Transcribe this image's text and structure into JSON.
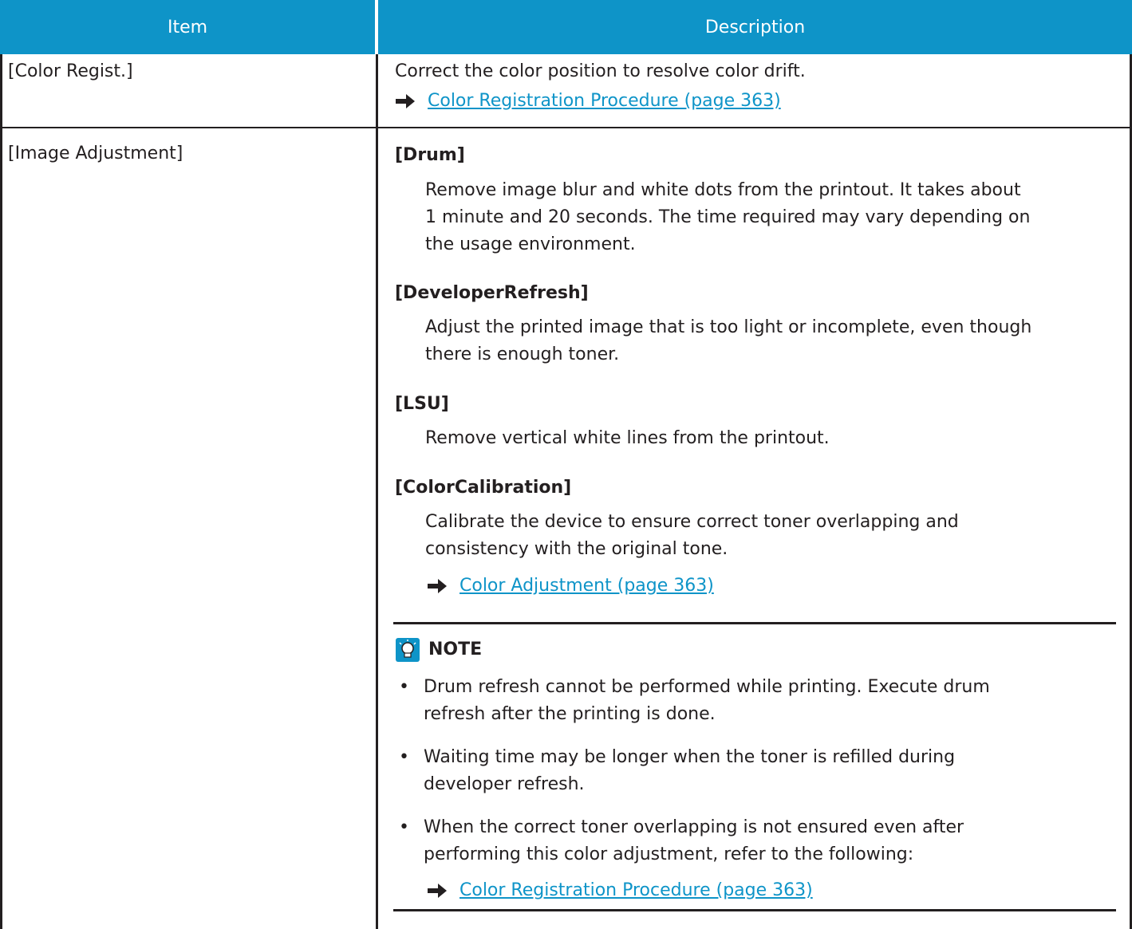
{
  "table": {
    "header": {
      "item": "Item",
      "description": "Description"
    },
    "rows": [
      {
        "item": "[Color Regist.]",
        "description": "Correct the color position to resolve color drift.",
        "link": "Color Registration Procedure (page 363)"
      },
      {
        "item": "[Image Adjustment]",
        "sections": [
          {
            "title": "[Drum]",
            "lines": [
              "Remove image blur and white dots from the printout. It takes about",
              "1 minute and 20 seconds. The time required may vary depending on",
              "the usage environment."
            ]
          },
          {
            "title": "[DeveloperRefresh]",
            "lines": [
              "Adjust the printed image that is too light or incomplete, even though",
              "there is enough toner."
            ]
          },
          {
            "title": "[LSU]",
            "lines": [
              "Remove vertical white lines from the printout."
            ]
          },
          {
            "title": "[ColorCalibration]",
            "lines": [
              "Calibrate the device to ensure correct toner overlapping and",
              "consistency with the original tone."
            ],
            "link": "Color Adjustment (page 363)"
          }
        ],
        "note": {
          "title": "NOTE",
          "bullets": [
            {
              "lines": [
                "Drum refresh cannot be performed while printing. Execute drum",
                "refresh after the printing is done."
              ]
            },
            {
              "lines": [
                "Waiting time may be longer when the toner is refilled during",
                "developer refresh."
              ]
            },
            {
              "lines": [
                "When the correct toner overlapping is not ensured even after",
                "performing this color adjustment, refer to the following:"
              ]
            }
          ],
          "link": "Color Registration Procedure (page 363)"
        }
      }
    ]
  },
  "colors": {
    "header_bg": "#0e94c8",
    "link": "#0e94c8",
    "rule": "#231f20",
    "text": "#231f20"
  },
  "icons": {
    "link_arrow": "right-arrow-icon",
    "note": "lightbulb-note-icon"
  }
}
